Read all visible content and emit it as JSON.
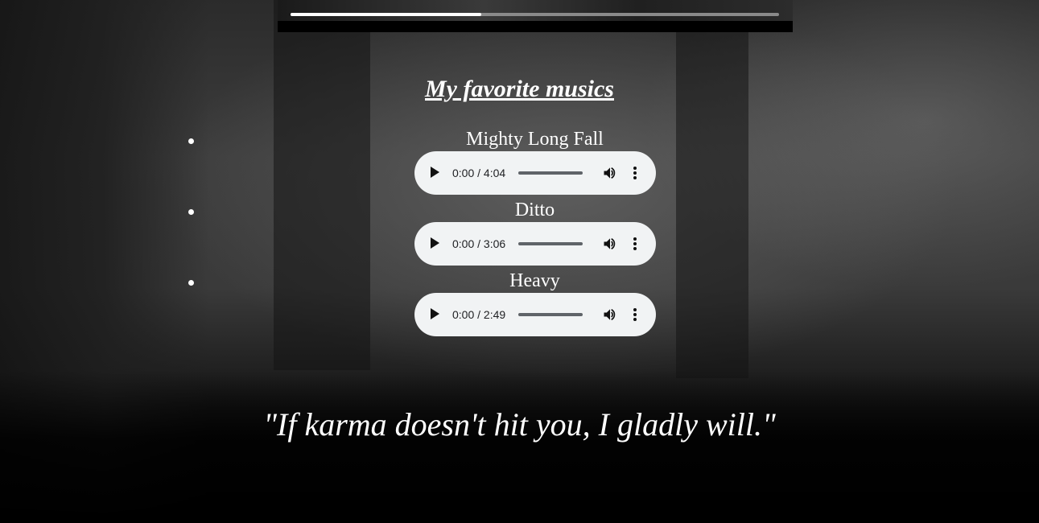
{
  "video": {
    "progress": 0.39
  },
  "section": {
    "title": "My favorite musics"
  },
  "songs": [
    {
      "title": "Mighty Long Fall",
      "time": "0:00 / 4:04"
    },
    {
      "title": "Ditto",
      "time": "0:00 / 3:06"
    },
    {
      "title": "Heavy",
      "time": "0:00 / 2:49"
    }
  ],
  "quote": {
    "text": "\"If karma doesn't hit you, I gladly will.\""
  },
  "icons": {
    "play": "play-icon",
    "volume": "volume-icon",
    "menu": "more-vert-icon"
  },
  "colors": {
    "text": "#ffffff",
    "player_bg": "#f1f3f4",
    "video_bg": "#000000"
  }
}
